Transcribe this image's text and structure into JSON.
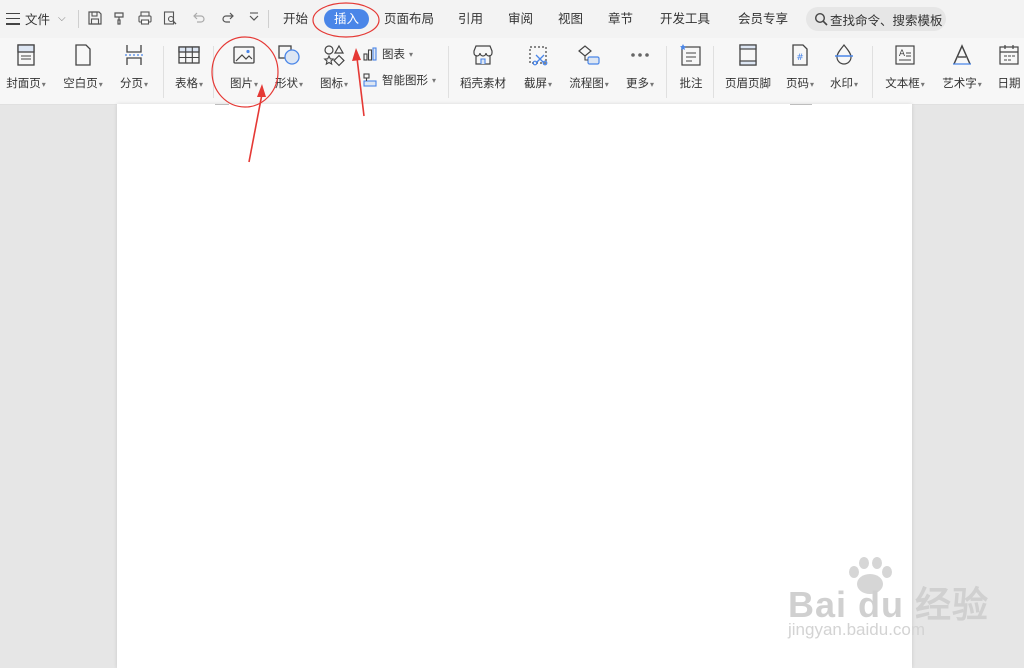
{
  "menubar": {
    "file_label": "文件",
    "tabs": [
      "开始",
      "插入",
      "页面布局",
      "引用",
      "审阅",
      "视图",
      "章节",
      "开发工具",
      "会员专享"
    ],
    "active_tab": "插入",
    "search_text": "查找命令、搜索模板"
  },
  "ribbon": {
    "buttons": [
      {
        "label": "封面页",
        "icon": "cover-page-icon",
        "dropdown": true
      },
      {
        "label": "空白页",
        "icon": "blank-page-icon",
        "dropdown": true
      },
      {
        "label": "分页",
        "icon": "page-break-icon",
        "dropdown": true
      },
      {
        "label": "表格",
        "icon": "table-icon",
        "dropdown": true
      },
      {
        "label": "图片",
        "icon": "picture-icon",
        "dropdown": true
      },
      {
        "label": "形状",
        "icon": "shape-icon",
        "dropdown": true
      },
      {
        "label": "图标",
        "icon": "icons-icon",
        "dropdown": true
      },
      {
        "label": "稻壳素材",
        "icon": "docer-material-icon",
        "dropdown": false
      },
      {
        "label": "截屏",
        "icon": "screenshot-icon",
        "dropdown": true
      },
      {
        "label": "流程图",
        "icon": "flowchart-icon",
        "dropdown": true
      },
      {
        "label": "更多",
        "icon": "more-icon",
        "dropdown": true
      },
      {
        "label": "批注",
        "icon": "comment-icon",
        "dropdown": false
      },
      {
        "label": "页眉页脚",
        "icon": "header-footer-icon",
        "dropdown": false
      },
      {
        "label": "页码",
        "icon": "page-number-icon",
        "dropdown": true
      },
      {
        "label": "水印",
        "icon": "watermark-icon",
        "dropdown": true
      },
      {
        "label": "文本框",
        "icon": "textbox-icon",
        "dropdown": true
      },
      {
        "label": "艺术字",
        "icon": "wordart-icon",
        "dropdown": true
      },
      {
        "label": "日期",
        "icon": "date-icon",
        "dropdown": false
      }
    ],
    "small_buttons": [
      {
        "label": "图表",
        "icon": "chart-icon",
        "dropdown": true
      },
      {
        "label": "智能图形",
        "icon": "smart-art-icon",
        "dropdown": true
      }
    ]
  },
  "watermark": {
    "main": "Bai du 经验",
    "sub": "jingyan.baidu.com"
  },
  "colors": {
    "accent": "#4a86e8",
    "annotation": "#e53935"
  }
}
